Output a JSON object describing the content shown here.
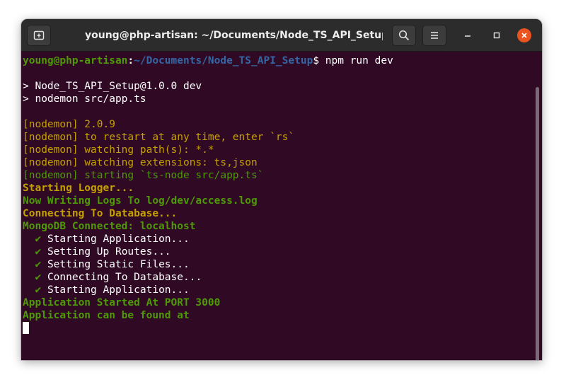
{
  "window": {
    "title": "young@php-artisan: ~/Documents/Node_TS_API_Setup"
  },
  "titlebar": {
    "new_tab_icon": "new-tab-icon",
    "search_icon": "search-icon",
    "menu_icon": "hamburger-menu-icon",
    "minimize_icon": "minimize-icon",
    "maximize_icon": "maximize-icon",
    "close_icon": "close-icon"
  },
  "colors": {
    "terminal_bg": "#300a24",
    "prompt_green": "#4e9a06",
    "path_blue": "#3465a4",
    "nodemon_amber": "#c4a000",
    "close_orange": "#e95420"
  },
  "terminal": {
    "prompt": {
      "user_host": "young@php-artisan",
      "separator": ":",
      "path": "~/Documents/Node_TS_API_Setup",
      "symbol": "$",
      "command": " npm run dev"
    },
    "npm_lines": [
      "> Node_TS_API_Setup@1.0.0 dev",
      "> nodemon src/app.ts"
    ],
    "nodemon_lines": [
      "[nodemon] 2.0.9",
      "[nodemon] to restart at any time, enter `rs`",
      "[nodemon] watching path(s): *.*",
      "[nodemon] watching extensions: ts,json"
    ],
    "nodemon_start_line": "[nodemon] starting `ts-node src/app.ts`",
    "logs": [
      {
        "text": "Starting Logger...",
        "color": "amber"
      },
      {
        "text": "Now Writing Logs To log/dev/access.log",
        "color": "green"
      },
      {
        "text": "Connecting To Database...",
        "color": "amber"
      },
      {
        "text": "MongoDB Connected: localhost",
        "color": "green"
      }
    ],
    "check_mark": "✔",
    "check_items": [
      "Starting Application...",
      "Setting Up Routes...",
      "Setting Static Files...",
      "Connecting To Database...",
      "Starting Application..."
    ],
    "final_lines": [
      "Application Started At PORT 3000",
      "Application can be found at"
    ]
  }
}
